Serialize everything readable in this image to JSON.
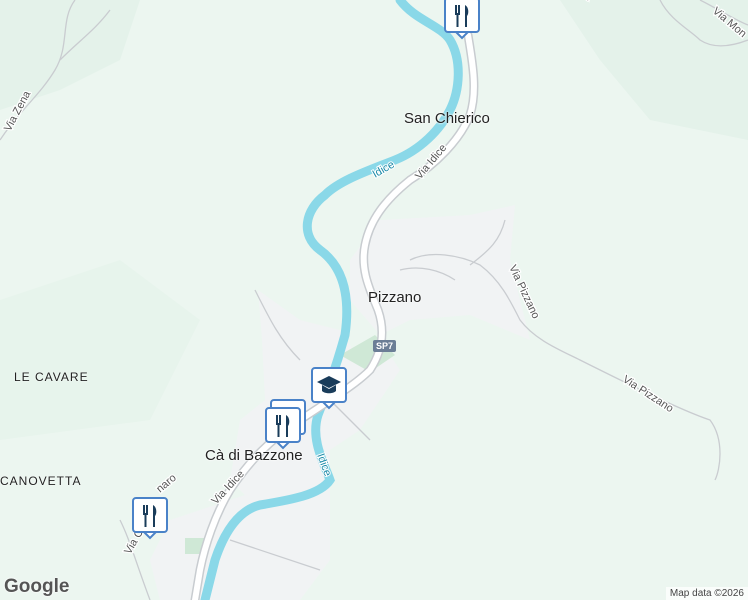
{
  "places": {
    "san_chierico": "San Chierico",
    "pizzano": "Pizzano",
    "ca_di_bazzone": "Cà di Bazzone"
  },
  "areas": {
    "le_cavare": "LE CAVARE",
    "canovetta": "CANOVETTA"
  },
  "roads": {
    "via_zena": "Via Zena",
    "via_idice_north": "Via Idice",
    "via_idice_south": "Via Idice",
    "via_pizzano_1": "Via Pizzano",
    "via_pizzano_2": "Via Pizzano",
    "via_mon": "Via Mon",
    "via_ro_naro": "naro",
    "via_ca": "Via C",
    "via_top": "V"
  },
  "rivers": {
    "idice_north": "Idice",
    "idice_south": "Idice"
  },
  "shield": {
    "sp7": "SP7"
  },
  "markers": [
    {
      "name": "restaurant-marker-north",
      "icon": "restaurant-icon"
    },
    {
      "name": "school-marker",
      "icon": "graduation-cap-icon"
    },
    {
      "name": "restaurant-marker-center-back",
      "icon": "restaurant-icon"
    },
    {
      "name": "restaurant-marker-center",
      "icon": "restaurant-icon"
    },
    {
      "name": "restaurant-marker-southwest",
      "icon": "restaurant-icon"
    }
  ],
  "brand": {
    "logo": "Google",
    "attribution": "Map data ©2026"
  },
  "colors": {
    "forest": "#ecf6f0",
    "forest_dark": "#dcefe4",
    "builtup": "#f1f3f4",
    "river": "#8ad8e8",
    "road": "#ffffff",
    "road_edge": "#c8ccd0",
    "marker_border": "#4a82c8",
    "marker_icon": "#1a3c5a"
  }
}
